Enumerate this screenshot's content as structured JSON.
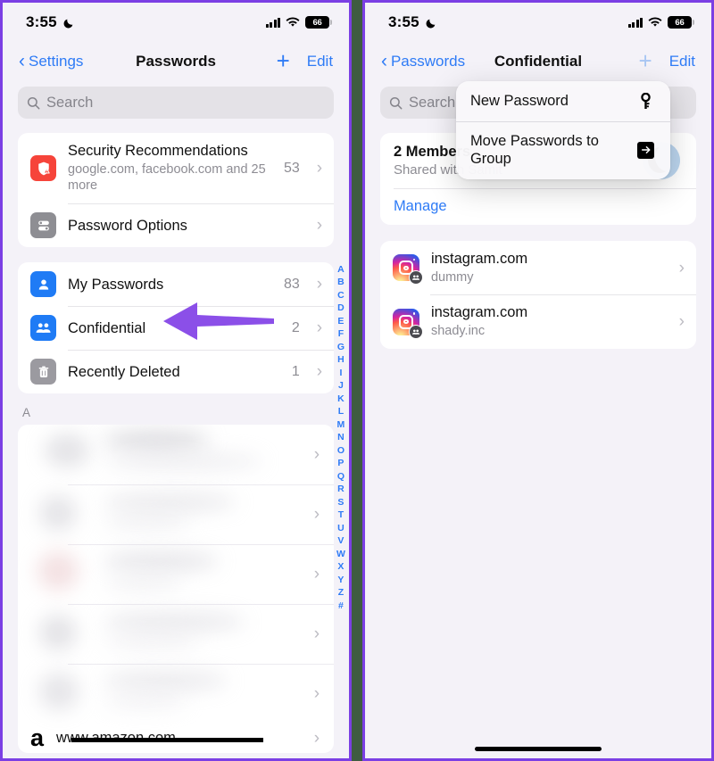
{
  "status_bar": {
    "time": "3:55",
    "moon_icon": "crescent-moon-icon",
    "signal_icon": "cellular-bars-icon",
    "wifi_icon": "wifi-icon",
    "battery_level": "66"
  },
  "left_panel": {
    "nav": {
      "back_label": "Settings",
      "title": "Passwords",
      "add_label": "+",
      "edit_label": "Edit"
    },
    "search": {
      "placeholder": "Search",
      "icon": "search-icon"
    },
    "group_one": [
      {
        "icon": "security-shield-warning-icon",
        "title": "Security Recommendations",
        "subtitle": "google.com, facebook.com and 25 more",
        "count": "53",
        "chevron": "›"
      },
      {
        "icon": "password-options-sliders-icon",
        "title": "Password Options",
        "subtitle": "",
        "count": "",
        "chevron": "›"
      }
    ],
    "group_two": [
      {
        "icon": "single-person-icon",
        "title": "My Passwords",
        "count": "83",
        "chevron": "›"
      },
      {
        "icon": "two-people-icon",
        "title": "Confidential",
        "count": "2",
        "chevron": "›"
      },
      {
        "icon": "trash-icon",
        "title": "Recently Deleted",
        "count": "1",
        "chevron": "›"
      }
    ],
    "section_header": "A",
    "blurred_rows": [
      {
        "chevron": "›"
      },
      {
        "chevron": "›"
      },
      {
        "chevron": "›"
      },
      {
        "chevron": "›"
      },
      {
        "chevron": "›"
      }
    ],
    "amazon_row": {
      "letter": "a",
      "url": "www.amazon.com",
      "chevron": "›"
    },
    "alphabet_index": [
      "A",
      "B",
      "C",
      "D",
      "E",
      "F",
      "G",
      "H",
      "I",
      "J",
      "K",
      "L",
      "M",
      "N",
      "O",
      "P",
      "Q",
      "R",
      "S",
      "T",
      "U",
      "V",
      "W",
      "X",
      "Y",
      "Z",
      "#"
    ]
  },
  "right_panel": {
    "nav": {
      "back_label": "Passwords",
      "title": "Confidential",
      "add_label": "+",
      "edit_label": "Edit"
    },
    "search": {
      "placeholder": "Search",
      "icon": "search-icon"
    },
    "members": {
      "title": "2 Members",
      "subtitle": "Shared with Samit",
      "manage_label": "Manage",
      "avatar": "contact-avatar"
    },
    "entries": [
      {
        "icon": "instagram-icon",
        "badge": "shared-group-badge",
        "title": "instagram.com",
        "subtitle": "dummy",
        "chevron": "›"
      },
      {
        "icon": "instagram-icon",
        "badge": "shared-group-badge",
        "title": "instagram.com",
        "subtitle": "shady.inc",
        "chevron": "›"
      }
    ],
    "context_menu": [
      {
        "label": "New Password",
        "icon": "key-icon"
      },
      {
        "label": "Move Passwords to Group",
        "icon": "arrow-right-box-icon"
      }
    ]
  },
  "annotations": {
    "arrow": {
      "name": "purple-pointer-arrow",
      "color": "#8b4fe8",
      "points_to": "Confidential"
    },
    "frame_color": "#7b3fe4",
    "divider_color": "#3f5c42"
  }
}
